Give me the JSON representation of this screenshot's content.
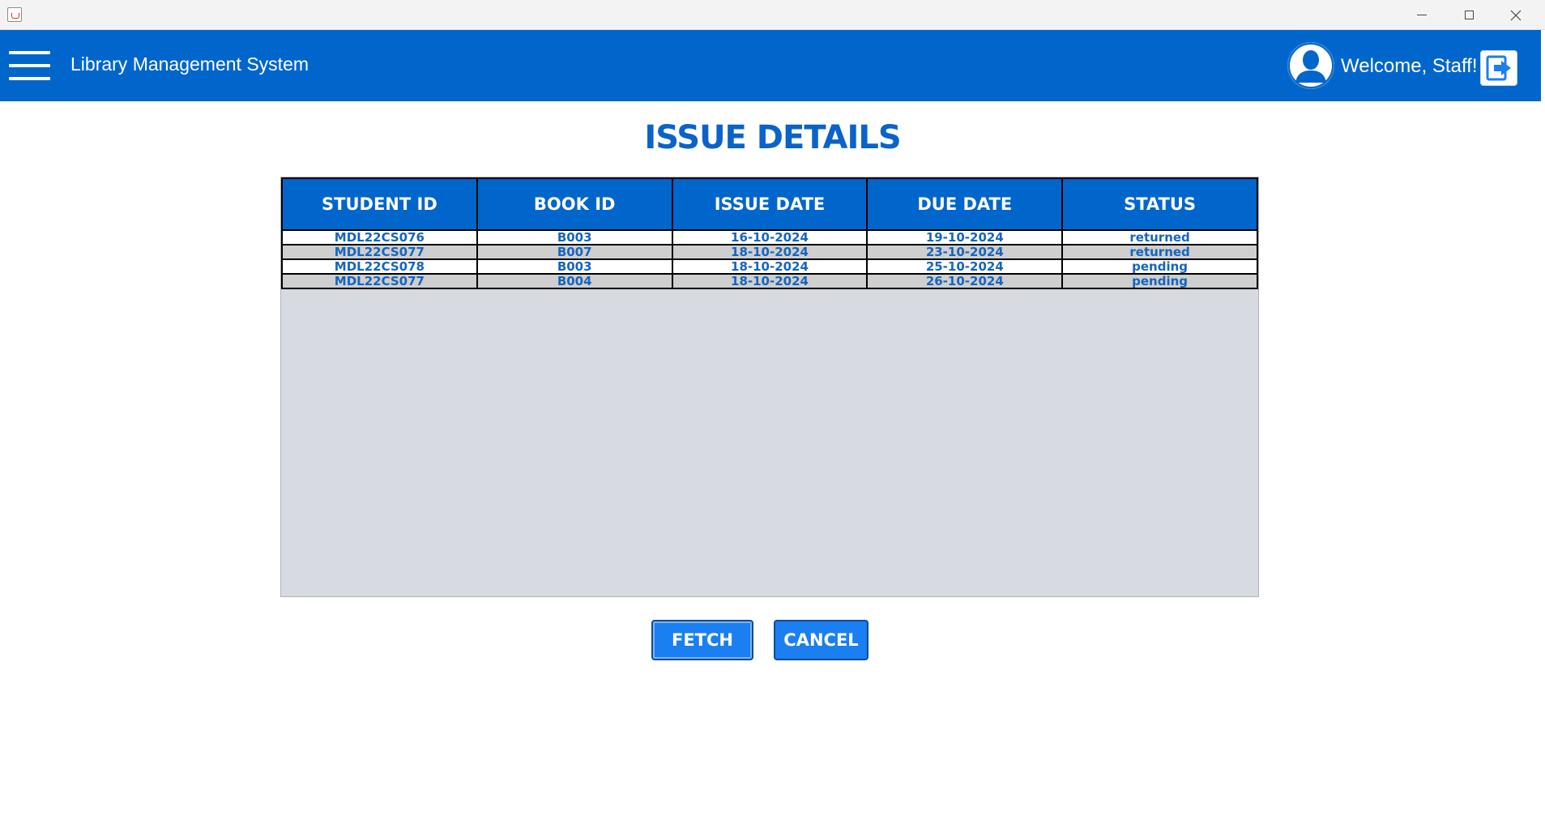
{
  "window": {
    "controls": {
      "minimize_icon": "minimize-icon",
      "maximize_icon": "maximize-icon",
      "close_icon": "close-icon"
    }
  },
  "header": {
    "title": "Library Management System",
    "welcome_text": "Welcome, Staff!",
    "menu_icon": "hamburger-menu-icon",
    "avatar_icon": "user-avatar-icon",
    "logout_icon": "logout-icon",
    "background_color": "#0066cc"
  },
  "page": {
    "title": "ISSUE DETAILS"
  },
  "issue_table": {
    "columns": [
      "STUDENT ID",
      "BOOK ID",
      "ISSUE DATE",
      "DUE DATE",
      "STATUS"
    ],
    "rows": [
      [
        "MDL22CS076",
        "B003",
        "16-10-2024",
        "19-10-2024",
        "returned"
      ],
      [
        "MDL22CS077",
        "B007",
        "18-10-2024",
        "23-10-2024",
        "returned"
      ],
      [
        "MDL22CS078",
        "B003",
        "18-10-2024",
        "25-10-2024",
        "pending"
      ],
      [
        "MDL22CS077",
        "B004",
        "18-10-2024",
        "26-10-2024",
        "pending"
      ]
    ]
  },
  "actions": {
    "fetch_label": "FETCH",
    "cancel_label": "CANCEL",
    "button_color": "#1a7ff0"
  }
}
